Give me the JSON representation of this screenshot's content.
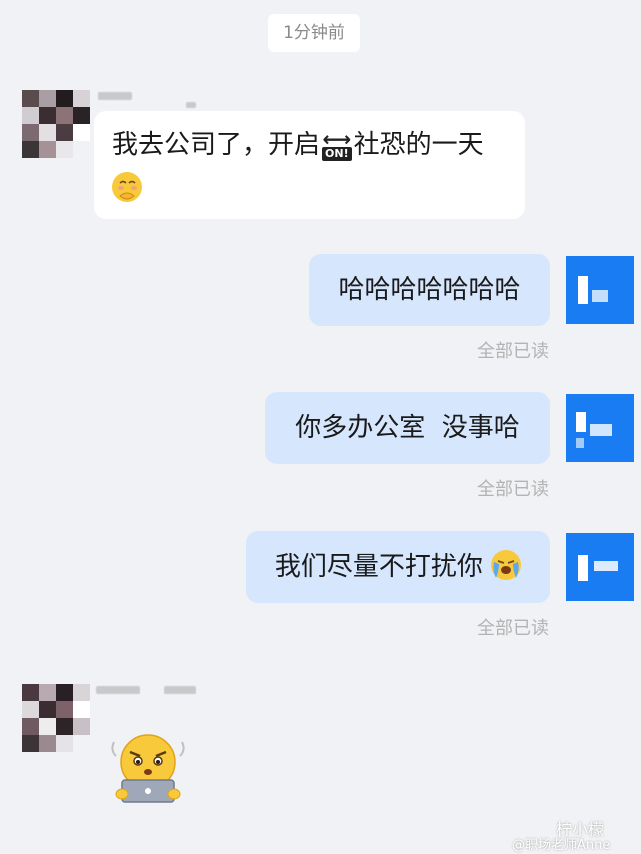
{
  "timestamp": "1分钟前",
  "messages": [
    {
      "side": "in",
      "text_before": "我去公司了，开启",
      "on_sign": "ON!",
      "text_after": "社恐的一天",
      "emoji": "smiling-face-with-hand-over-mouth"
    },
    {
      "side": "out",
      "text": "哈哈哈哈哈哈哈",
      "status": "全部已读"
    },
    {
      "side": "out",
      "text": "你多办公室  没事哈",
      "status": "全部已读"
    },
    {
      "side": "out",
      "text": "我们尽量不打扰你",
      "emoji": "loudly-crying-face",
      "status": "全部已读"
    },
    {
      "side": "in",
      "sticker": "sticker-face-with-laptop"
    }
  ],
  "watermark": {
    "account": "柠小檬",
    "handle": "@职场老师Anne"
  },
  "colors": {
    "background": "#f1f2f5",
    "bubble_in": "#ffffff",
    "bubble_out": "#d6e7fd",
    "self_avatar": "#1a7cf3"
  }
}
